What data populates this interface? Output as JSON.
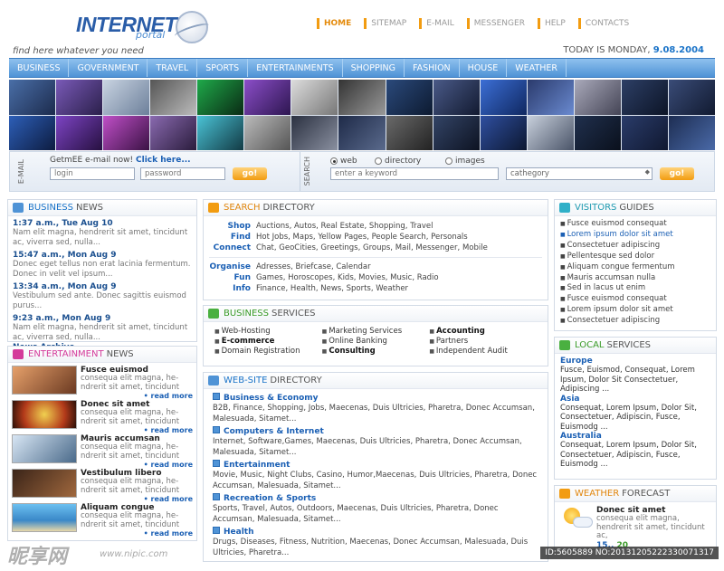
{
  "logo": {
    "title": "INTERNET",
    "subtitle": "portal"
  },
  "tagline": "find here whatever you need",
  "topnav": [
    "HOME",
    "SITEMAP",
    "E-MAIL",
    "MESSENGER",
    "HELP",
    "CONTACTS"
  ],
  "date": {
    "prefix": "TODAY IS MONDAY,",
    "value": "9.08.2004"
  },
  "mainnav": [
    "BUSINESS",
    "GOVERNMENT",
    "TRAVEL",
    "SPORTS",
    "ENTERTAINMENTS",
    "SHOPPING",
    "FASHION",
    "HOUSE",
    "WEATHER"
  ],
  "email": {
    "label": "E-MAIL",
    "title": "GetmEE e-mail now!",
    "link": "Click here...",
    "login_placeholder": "login",
    "password_placeholder": "password",
    "go": "go!"
  },
  "search": {
    "label": "SEARCH",
    "options": [
      "web",
      "directory",
      "images"
    ],
    "selected": "web",
    "keyword_placeholder": "enter a keyword",
    "category": "cathegory",
    "go": "go!"
  },
  "business_news": {
    "title_hl": "BUSINESS",
    "title": "NEWS",
    "items": [
      {
        "time": "1:37 a.m., Tue Aug 10",
        "text": "Nam elit magna, hendrerit sit amet, tincidunt ac, viverra sed, nulla..."
      },
      {
        "time": "15:47 a.m., Mon Aug 9",
        "text": "Donec eget tellus non erat lacinia fermentum. Donec in velit vel ipsum..."
      },
      {
        "time": "13:34 a.m., Mon Aug 9",
        "text": "Vestibulum sed ante. Donec sagittis euismod purus..."
      },
      {
        "time": "9:23 a.m., Mon Aug 9",
        "text": "Nam elit magna, hendrerit sit amet, tincidunt ac, viverra sed, nulla..."
      }
    ],
    "archive": "News Archive"
  },
  "ent_news": {
    "title_hl": "ENTERTAINMENT",
    "title": "NEWS",
    "items": [
      {
        "title": "Fusce euismod",
        "text": "consequa elit magna, he-ndrerit sit amet, tincidunt",
        "more": "• read more"
      },
      {
        "title": "Donec sit amet",
        "text": "consequa elit magna, he-ndrerit sit amet, tincidunt",
        "more": "• read more"
      },
      {
        "title": "Mauris accumsan",
        "text": "consequa elit magna, he-ndrerit sit amet, tincidunt",
        "more": "• read more"
      },
      {
        "title": "Vestibulum libero",
        "text": "consequa elit magna, he-ndrerit sit amet, tincidunt",
        "more": "• read more"
      },
      {
        "title": "Aliquam congue",
        "text": "consequa elit magna, he-ndrerit sit amet, tincidunt",
        "more": "• read more"
      }
    ]
  },
  "search_dir": {
    "title_hl": "SEARCH",
    "title": "DIRECTORY",
    "rows1": [
      {
        "label": "Shop",
        "text": "Auctions, Autos, Real Estate, Shopping, Travel"
      },
      {
        "label": "Find",
        "text": "Hot Jobs, Maps, Yellow Pages, People Search, Personals"
      },
      {
        "label": "Connect",
        "text": "Chat, GeoCities, Greetings, Groups, Mail, Messenger, Mobile"
      }
    ],
    "rows2": [
      {
        "label": "Organise",
        "text": "Adresses, Briefcase, Calendar"
      },
      {
        "label": "Fun",
        "text": "Games, Horoscopes, Kids, Movies, Music, Radio"
      },
      {
        "label": "Info",
        "text": "Finance, Health, News, Sports, Weather"
      }
    ]
  },
  "biz_services": {
    "title_hl": "BUSINESS",
    "title": "SERVICES",
    "items": [
      "Web-Hosting",
      "Marketing Services",
      "Accounting",
      "E-commerce",
      "Online Banking",
      "Partners",
      "Domain Registration",
      "Consulting",
      "Independent Audit"
    ]
  },
  "web_dir": {
    "title_hl": "WEB-SITE",
    "title": "DIRECTORY",
    "cats": [
      {
        "name": "Business & Economy",
        "text": "B2B, Finance, Shopping, Jobs, Maecenas, Duis Ultricies, Pharetra, Donec Accumsan, Malesuada, Sitamet..."
      },
      {
        "name": "Computers & Internet",
        "text": "Internet, Software,Games, Maecenas, Duis Ultricies, Pharetra, Donec Accumsan, Malesuada, Sitamet..."
      },
      {
        "name": "Entertainment",
        "text": "Movie, Music, Night Clubs, Casino, Humor,Maecenas, Duis Ultricies, Pharetra, Donec Accumsan, Malesuada, Sitamet..."
      },
      {
        "name": "Recreation & Sports",
        "text": "Sports, Travel, Autos, Outdoors, Maecenas, Duis Ultricies, Pharetra, Donec Accumsan, Malesuada, Sitamet..."
      },
      {
        "name": "Health",
        "text": "Drugs, Diseases, Fitness, Nutrition, Maecenas, Donec Accumsan, Malesuada, Duis Ultricies, Pharetra..."
      }
    ]
  },
  "guides": {
    "title_hl": "VISITORS",
    "title": "GUIDES",
    "items": [
      "Fusce euismod consequat",
      "Lorem ipsum dolor sit amet",
      "Consectetuer adipiscing",
      "Pellentesque sed dolor",
      "Aliquam congue fermentum",
      "Mauris accumsan nulla",
      "Sed in lacus ut enim",
      "Fusce euismod consequat",
      "Lorem ipsum dolor sit amet",
      "Consectetuer adipiscing"
    ]
  },
  "local": {
    "title_hl": "LOCAL",
    "title": "SERVICES",
    "regions": [
      {
        "name": "Europe",
        "text": "Fusce, Euismod, Consequat, Lorem Ipsum, Dolor Sit Consectetuer, Adipiscing ..."
      },
      {
        "name": "Asia",
        "text": "Consequat, Lorem Ipsum, Dolor Sit, Consectetuer, Adipiscin, Fusce, Euismodg ..."
      },
      {
        "name": "Australia",
        "text": "Consequat, Lorem Ipsum, Dolor Sit, Consectetuer, Adipiscin, Fusce, Euismodg ..."
      }
    ]
  },
  "weather": {
    "title_hl": "WEATHER",
    "title": "FORECAST",
    "place": "Donec sit amet",
    "text": "consequa elit magna, hendrerit sit amet, tincidunt ac,",
    "temp": "15..",
    "temp2": "20"
  },
  "watermark": {
    "brand": "昵享网",
    "url": "www.nipic.com",
    "id": "ID:5605889 NO:20131205222330071317"
  }
}
